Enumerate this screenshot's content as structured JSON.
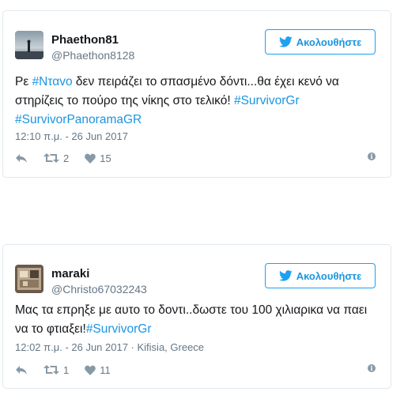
{
  "tweets": [
    {
      "name": "Phaethon81",
      "handle": "@Phaethon8128",
      "follow_label": "Ακολουθήστε",
      "text_parts": {
        "p1": "Ρε ",
        "h1": "#Νταvo",
        "p2": " δεν πειράζει το σπασμένο δόντι...θα έχει κενό να στηρίζεις το πούρο της νίκης στο τελικό! ",
        "h2": "#SurvivorGr",
        "p3": " ",
        "h3": "#SurvivorPanoramaGR"
      },
      "timestamp": "12:10 π.μ. - 26 Jun 2017",
      "retweets": "2",
      "likes": "15",
      "avatar_icon": "landscape-avatar-icon"
    },
    {
      "name": "maraki",
      "handle": "@Christo67032243",
      "follow_label": "Ακολουθήστε",
      "text_parts": {
        "p1": "Μας τα επρηξε με αυτο το δοντι..δωστε του 100 χιλιαρικα να παει να το φτιαξει!",
        "h1": "#SurvivorGr"
      },
      "timestamp": "12:02 π.μ. - 26 Jun 2017 · Kifisia, Greece",
      "retweets": "1",
      "likes": "11",
      "avatar_icon": "photo-avatar-icon"
    }
  ],
  "colors": {
    "link": "#1b95e0",
    "follow_border": "#1da1f2",
    "muted": "#657786",
    "border": "#e1e8ed"
  }
}
